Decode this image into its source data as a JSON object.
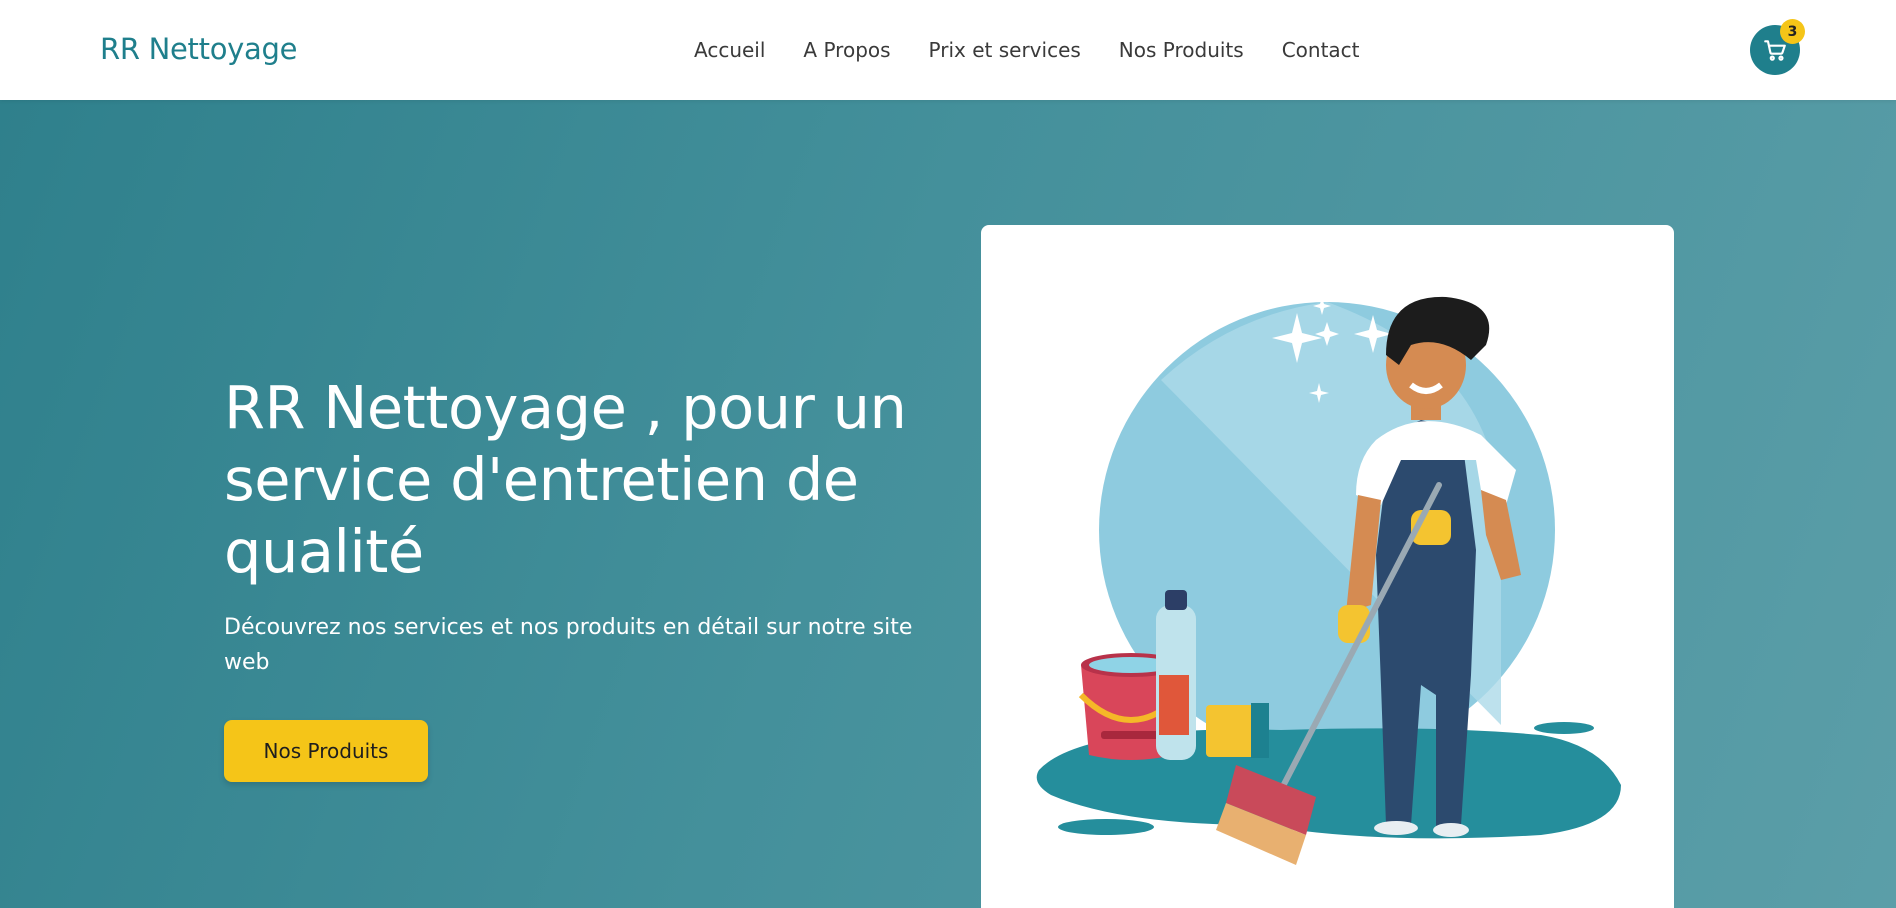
{
  "header": {
    "brand": "RR Nettoyage",
    "nav": [
      {
        "label": "Accueil"
      },
      {
        "label": "A Propos"
      },
      {
        "label": "Prix et services"
      },
      {
        "label": "Nos Produits"
      },
      {
        "label": "Contact"
      }
    ],
    "cart": {
      "count": "3",
      "icon": "cart-icon"
    }
  },
  "hero": {
    "title": "RR Nettoyage , pour un service d'entretien de qualité",
    "subtitle": "Découvrez nos services et nos produits en détail sur notre site web",
    "cta_label": "Nos Produits",
    "illustration": "cleaner-with-mop-illustration"
  },
  "colors": {
    "brand": "#1f7f8c",
    "accent": "#f5c518",
    "hero_bg_start": "#2f808c",
    "hero_bg_end": "#5b9ea8"
  }
}
